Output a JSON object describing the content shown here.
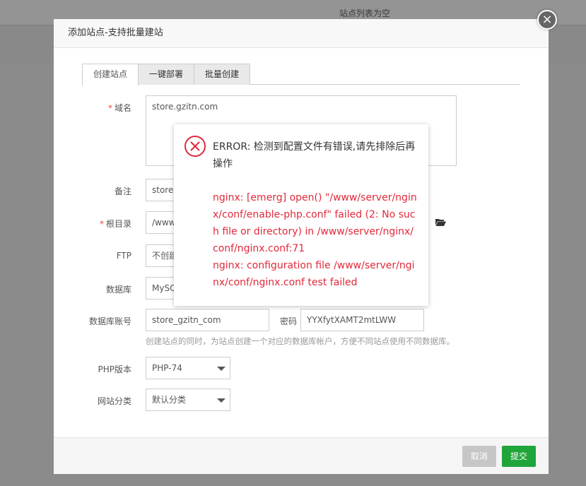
{
  "background": {
    "empty_text": "站点列表为空"
  },
  "modal": {
    "title": "添加站点-支持批量建站",
    "close_symbol": "×",
    "tabs": [
      {
        "label": "创建站点"
      },
      {
        "label": "一键部署"
      },
      {
        "label": "批量创建"
      }
    ],
    "form": {
      "domain": {
        "label": "域名",
        "value": "store.gzitn.com"
      },
      "remark": {
        "label": "备注",
        "value": "store"
      },
      "root": {
        "label": "根目录",
        "value": "/www"
      },
      "ftp": {
        "label": "FTP",
        "value": "不创建"
      },
      "database": {
        "label": "数据库",
        "value": "MySQL"
      },
      "db_account": {
        "label": "数据库账号",
        "value": "store_gzitn_com"
      },
      "db_password": {
        "label": "密码",
        "value": "YYXfytXAMT2mtLWW"
      },
      "db_hint": "创建站点的同时，为站点创建一个对应的数据库帐户，方便不同站点使用不同数据库。",
      "php": {
        "label": "PHP版本",
        "value": "PHP-74"
      },
      "category": {
        "label": "网站分类",
        "value": "默认分类"
      },
      "required_mark": "*"
    },
    "buttons": {
      "cancel": "取消",
      "submit": "提交"
    }
  },
  "error_dialog": {
    "message": "ERROR: 检测到配置文件有错误,请先排除后再操作",
    "detail_line1": "nginx: [emerg] open() \"/www/server/nginx/conf/enable-php.conf\" failed (2: No such file or directory) in /www/server/nginx/conf/nginx.conf:71",
    "detail_line2": "nginx: configuration file /www/server/nginx/conf/nginx.conf test failed"
  },
  "colors": {
    "error_red": "#e1293a",
    "submit_green": "#20a53a",
    "required_red": "#e84c3d"
  },
  "icons": {
    "error": "error-circle-x-icon",
    "folder": "folder-open-icon",
    "close": "close-icon"
  }
}
